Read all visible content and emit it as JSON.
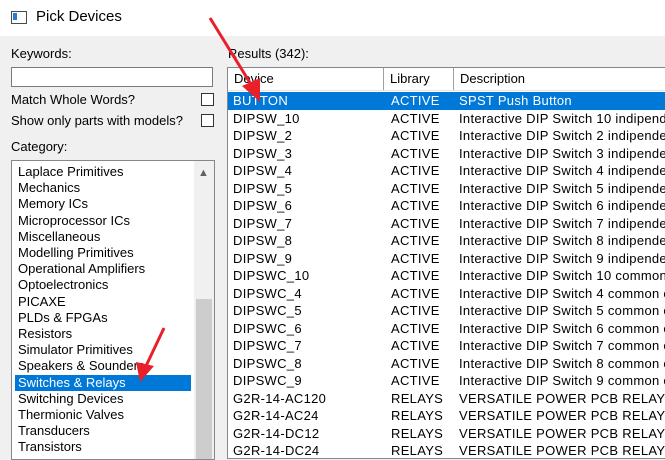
{
  "window": {
    "title": "Pick Devices"
  },
  "left": {
    "keywords_label": "Keywords:",
    "keywords_value": "",
    "match_whole_words_label": "Match Whole Words?",
    "show_models_label": "Show only parts with models?",
    "category_label": "Category:",
    "categories": [
      "Laplace Primitives",
      "Mechanics",
      "Memory ICs",
      "Microprocessor ICs",
      "Miscellaneous",
      "Modelling Primitives",
      "Operational Amplifiers",
      "Optoelectronics",
      "PICAXE",
      "PLDs & FPGAs",
      "Resistors",
      "Simulator Primitives",
      "Speakers & Sounders",
      "Switches & Relays",
      "Switching Devices",
      "Thermionic Valves",
      "Transducers",
      "Transistors"
    ],
    "selected_category": "Switches & Relays"
  },
  "results": {
    "label": "Results (342):",
    "columns": [
      "Device",
      "Library",
      "Description"
    ],
    "rows": [
      [
        "BUTTON",
        "ACTIVE",
        "SPST Push Button"
      ],
      [
        "DIPSW_10",
        "ACTIVE",
        "Interactive DIP Switch 10 indipend"
      ],
      [
        "DIPSW_2",
        "ACTIVE",
        "Interactive DIP Switch 2 indipender"
      ],
      [
        "DIPSW_3",
        "ACTIVE",
        "Interactive DIP Switch 3 indipender"
      ],
      [
        "DIPSW_4",
        "ACTIVE",
        "Interactive DIP Switch 4 indipender"
      ],
      [
        "DIPSW_5",
        "ACTIVE",
        "Interactive DIP Switch 5 indipender"
      ],
      [
        "DIPSW_6",
        "ACTIVE",
        "Interactive DIP Switch 6 indipender"
      ],
      [
        "DIPSW_7",
        "ACTIVE",
        "Interactive DIP Switch 7 indipender"
      ],
      [
        "DIPSW_8",
        "ACTIVE",
        "Interactive DIP Switch 8 indipender"
      ],
      [
        "DIPSW_9",
        "ACTIVE",
        "Interactive DIP Switch 9 indipender"
      ],
      [
        "DIPSWC_10",
        "ACTIVE",
        "Interactive DIP Switch 10 common"
      ],
      [
        "DIPSWC_4",
        "ACTIVE",
        "Interactive DIP Switch 4 common e"
      ],
      [
        "DIPSWC_5",
        "ACTIVE",
        "Interactive DIP Switch 5 common e"
      ],
      [
        "DIPSWC_6",
        "ACTIVE",
        "Interactive DIP Switch 6 common e"
      ],
      [
        "DIPSWC_7",
        "ACTIVE",
        "Interactive DIP Switch 7 common e"
      ],
      [
        "DIPSWC_8",
        "ACTIVE",
        "Interactive DIP Switch 8 common e"
      ],
      [
        "DIPSWC_9",
        "ACTIVE",
        "Interactive DIP Switch 9 common e"
      ],
      [
        "G2R-14-AC120",
        "RELAYS",
        "VERSATILE POWER PCB RELAY"
      ],
      [
        "G2R-14-AC24",
        "RELAYS",
        "VERSATILE POWER PCB RELAY"
      ],
      [
        "G2R-14-DC12",
        "RELAYS",
        "VERSATILE POWER PCB RELAY"
      ],
      [
        "G2R-14-DC24",
        "RELAYS",
        "VERSATILE POWER PCB RELAY"
      ]
    ],
    "selected_row": 0
  },
  "colors": {
    "selection": "#0078d7",
    "annotation_arrow": "#e8202a"
  }
}
